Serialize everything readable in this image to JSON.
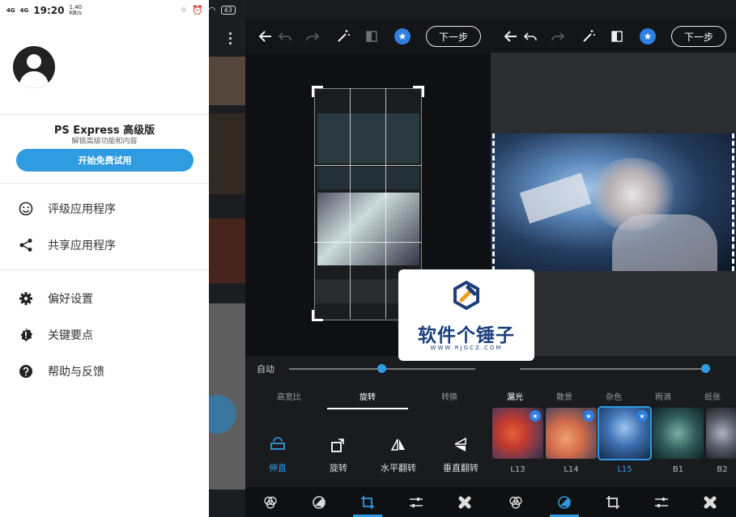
{
  "status_bar": {
    "signal_1": "4G",
    "signal_2": "4G",
    "time": "19:20",
    "speed_top": "1.40",
    "speed_bottom": "KB/s",
    "battery": "43"
  },
  "drawer": {
    "pro_title": "PS Express 高级版",
    "pro_subtitle": "解锁高级功能和内容",
    "trial_button": "开始免费试用",
    "menu": [
      {
        "label": "评级应用程序",
        "icon": "smiley-icon"
      },
      {
        "label": "共享应用程序",
        "icon": "share-icon"
      },
      {
        "label": "偏好设置",
        "icon": "gear-icon"
      },
      {
        "label": "关键要点",
        "icon": "alert-badge-icon"
      },
      {
        "label": "帮助与反馈",
        "icon": "help-icon"
      }
    ]
  },
  "editor_left": {
    "next_button": "下一步",
    "slider_label": "自动",
    "tabs": [
      "高宽比",
      "旋转",
      "转换"
    ],
    "active_tab": "旋转",
    "tools": [
      "伸直",
      "旋转",
      "水平翻转",
      "垂直翻转"
    ]
  },
  "editor_right": {
    "next_button": "下一步",
    "tabs": [
      "漏光",
      "散景",
      "杂色",
      "雨滴",
      "纸张"
    ],
    "active_tab": "漏光",
    "thumbnails": [
      "L13",
      "L14",
      "L15",
      "B1",
      "B2"
    ]
  },
  "watermark": {
    "title": "软件个锤子",
    "url": "WWW.RJGCZ.COM"
  },
  "colors": {
    "accent": "#2f9be0",
    "star": "#2f7fe0",
    "toolbar": "#141518"
  }
}
